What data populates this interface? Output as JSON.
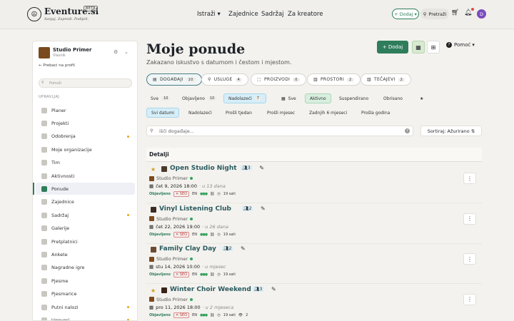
{
  "header": {
    "logo_text": "Eventure.si",
    "beta": "BETA",
    "tagline": "Sanjaj. Zapredi. Podijeli.",
    "nav": [
      "Istraži ▾",
      "Zajednice",
      "Sadržaj",
      "Za kreatore"
    ],
    "add_label": "+ Dodaj ▾",
    "search_label": "Pretraži",
    "avatar_letter": "D"
  },
  "sidebar": {
    "org_name": "Studio Primer",
    "org_role": "Vlasnik",
    "back_label": "← Prebaci na profil",
    "search_placeholder": "Potraži",
    "section": "UPRAVLJAJ",
    "items": [
      {
        "label": "Planer",
        "dot": false
      },
      {
        "label": "Projekti",
        "dot": false
      },
      {
        "label": "Odobrenja",
        "dot": true
      },
      {
        "label": "Moje organizacije",
        "dot": false
      },
      {
        "label": "Tim",
        "dot": false
      },
      {
        "label": "Aktivnosti",
        "dot": false
      },
      {
        "label": "Ponude",
        "dot": false,
        "active": true
      },
      {
        "label": "Zajednice",
        "dot": false
      },
      {
        "label": "Sadržaj",
        "dot": true
      },
      {
        "label": "Galerije",
        "dot": false
      },
      {
        "label": "Pretplatnici",
        "dot": false
      },
      {
        "label": "Ankete",
        "dot": false
      },
      {
        "label": "Nagradne igre",
        "dot": false
      },
      {
        "label": "Pjesme",
        "dot": false
      },
      {
        "label": "Pjesmarice",
        "dot": false
      },
      {
        "label": "Putni nalozi",
        "dot": true
      },
      {
        "label": "Ugovori",
        "dot": true
      }
    ]
  },
  "main": {
    "title": "Moje ponude",
    "subtitle": "Zakazano iskustvo s datumom i čestom i mjestom.",
    "add_button": "+ Dodaj",
    "help_label": "Pomoć ▾",
    "tabs": [
      {
        "label": "DOGAĐAJI",
        "count": "10",
        "active": true
      },
      {
        "label": "USLUGE",
        "count": "4"
      },
      {
        "label": "PROIZVODI",
        "count": "0"
      },
      {
        "label": "PROSTORI",
        "count": "2"
      },
      {
        "label": "TEČAJEVI",
        "count": "2"
      }
    ],
    "status_filters": [
      {
        "label": "Sve",
        "count": "10"
      },
      {
        "label": "Objavljeno",
        "count": "10"
      },
      {
        "label": "Nadolazeći",
        "count": "7",
        "on": true
      }
    ],
    "state_filters": [
      {
        "label": "Sve"
      },
      {
        "label": "Aktivno",
        "on": true
      },
      {
        "label": "Suspendirano"
      },
      {
        "label": "Obrisano"
      }
    ],
    "time_filters": [
      "Svi datumi",
      "Nadolazeći",
      "Prošli tjedan",
      "Prošli mjesec",
      "Zadnjih 6 mjeseci",
      "Prošla godina"
    ],
    "search_placeholder": "išči događaje...",
    "sort_label": "Sortiraj: Ažurirano ⇅",
    "details_header": "Detalji"
  },
  "rows": [
    {
      "title": "Open Studio Night",
      "group": "3",
      "star": true,
      "org": "Studio Primer",
      "date": "čet 9, 2026 18:00",
      "rel": "· u 13 dana",
      "status": "Objavljeno",
      "seo": "✕ SEO",
      "lang": "EN",
      "hours": "19 sati",
      "extra": ""
    },
    {
      "title": "Vinyl Listening Club",
      "group": "2",
      "star": false,
      "org": "Studio Primer",
      "date": "čet 22, 2026 19:00",
      "rel": "· u 26 dana",
      "status": "Objavljeno",
      "seo": "✕ SEO",
      "lang": "EN",
      "hours": "19 sati",
      "extra": ""
    },
    {
      "title": "Family Clay Day",
      "group": "2",
      "star": false,
      "org": "Studio Primer",
      "date": "stu 14, 2026 10:00",
      "rel": "· u mjesec",
      "status": "Objavljeno",
      "seo": "✕ SEO",
      "lang": "EN",
      "hours": "19 sati",
      "extra": ""
    },
    {
      "title": "Winter Choir Weekend",
      "group": "3",
      "star": true,
      "org": "Studio Primer",
      "date": "pro 11, 2026 18:00",
      "rel": "· u 2 mjeseca",
      "status": "Objavljeno",
      "seo": "✕ SEO",
      "lang": "EN",
      "hours": "19 sati",
      "extra": "2"
    }
  ]
}
